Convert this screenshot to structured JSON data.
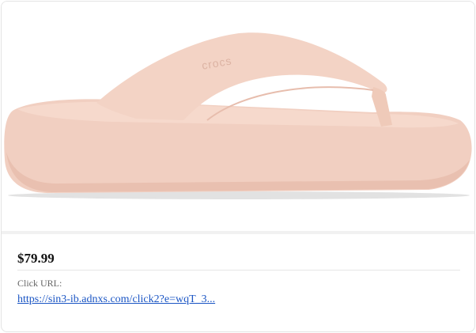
{
  "product": {
    "image_alt": "Pink platform flip-flop sandal",
    "logo_text": "crocs",
    "price": "$79.99",
    "click_url_label": "Click URL:",
    "click_url_text": "https://sin3-ib.adnxs.com/click2?e=wqT_3..."
  },
  "colors": {
    "sandal_body": "#f2d0c2",
    "sandal_shadow": "#dcb0a1",
    "link": "#1a55c4"
  }
}
